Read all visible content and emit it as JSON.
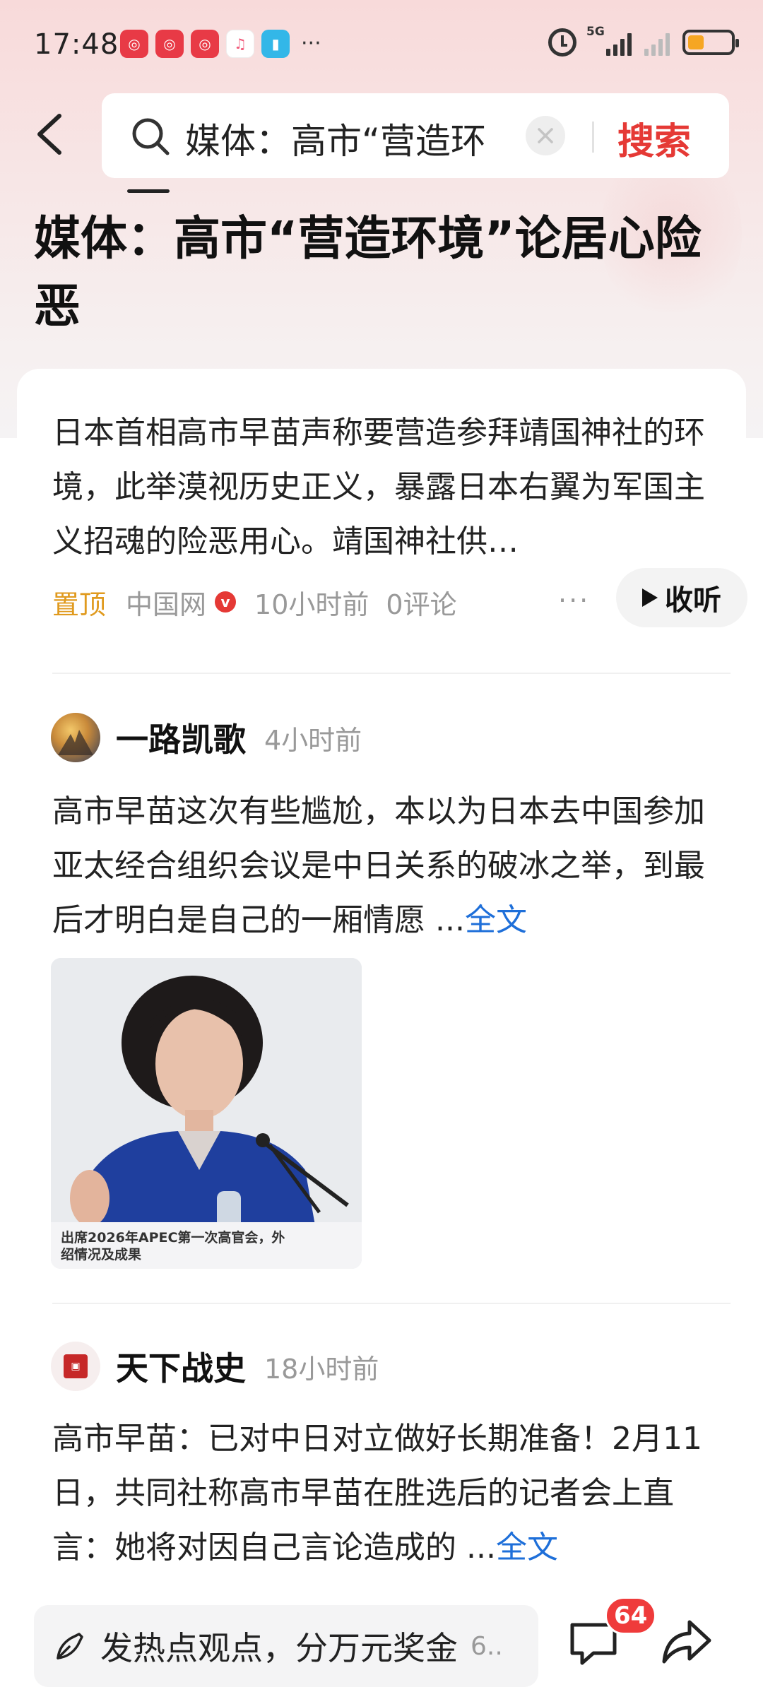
{
  "status_bar": {
    "time": "17:48",
    "app_icons": [
      "app-icon",
      "app-icon",
      "app-icon",
      "music-icon",
      "reader-icon"
    ],
    "more": "···",
    "network_label": "5G"
  },
  "search": {
    "query": "媒体：高市“营造环",
    "button_label": "搜索"
  },
  "article": {
    "title": "媒体：高市“营造环境”论居心险恶",
    "summary": "日本首相高市早苗声称要营造参拜靖国神社的环境，此举漠视历史正义，暴露日本右翼为军国主义招魂的险恶用心。靖国神社供…",
    "pinned": "置顶",
    "source": "中国网",
    "verified_mark": "v",
    "time": "10小时前",
    "comments": "0评论",
    "more": "···",
    "listen_label": "收听"
  },
  "posts": [
    {
      "author": "一路凯歌",
      "time": "4小时前",
      "text": "高市早苗这次有些尴尬，本以为日本去中国参加亚太经合组织会议是中日关系的破冰之举，到最后才明白是自己的一厢情愿 ...",
      "more_link": "全文",
      "image_caption": "出席2026年APEC第一次高官会，外\n绍情况及成果"
    },
    {
      "author": "天下战史",
      "time": "18小时前",
      "text": "高市早苗：已对中日对立做好长期准备！2月11日，共同社称高市早苗在胜选后的记者会上直言：她将对因自己言论造成的 ...",
      "more_link": "全文"
    }
  ],
  "bottom_bar": {
    "comment_placeholder": "发热点观点，分万元奖金",
    "comment_suffix": "6..",
    "badge_count": "64"
  }
}
